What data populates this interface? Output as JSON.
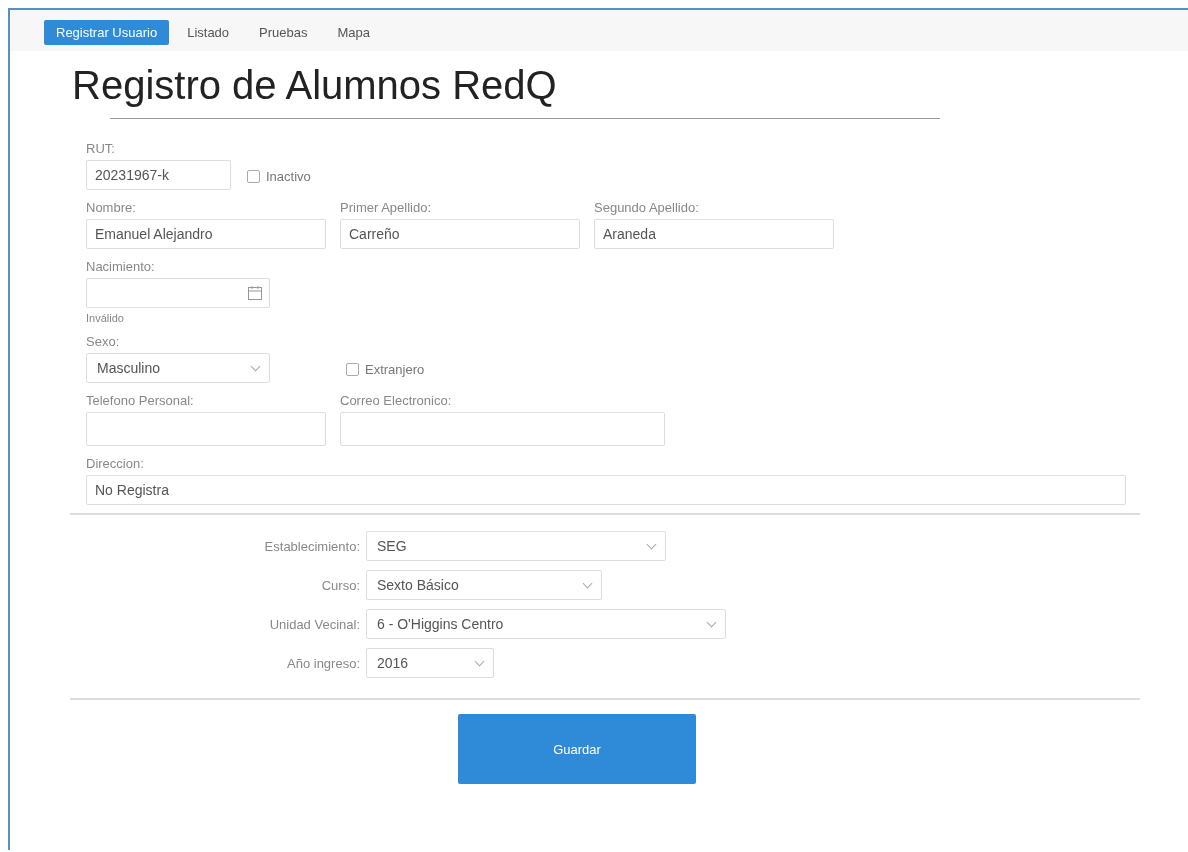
{
  "nav": [
    {
      "label": "Registrar Usuario",
      "selected": true
    },
    {
      "label": "Listado",
      "selected": false
    },
    {
      "label": "Pruebas",
      "selected": false
    },
    {
      "label": "Mapa",
      "selected": false
    }
  ],
  "title": "Registro de Alumnos RedQ",
  "rut": {
    "label": "RUT:",
    "value": "20231967-k"
  },
  "inactivo": {
    "label": "Inactivo",
    "checked": false
  },
  "names": [
    {
      "label": "Nombre:",
      "value": "Emanuel Alejandro"
    },
    {
      "label": "Primer Apellido:",
      "value": "Carreño"
    },
    {
      "label": "Segundo Apellido:",
      "value": "Araneda"
    }
  ],
  "nacimiento": {
    "label": "Nacimiento:",
    "note": "Inválido"
  },
  "sexo": {
    "label": "Sexo:",
    "value": "Masculino"
  },
  "extranjero": {
    "label": "Extranjero",
    "checked": false
  },
  "contact": [
    {
      "label": "Telefono Personal:"
    },
    {
      "label": "Correo Electronico:"
    }
  ],
  "direccion": {
    "label": "Direccion:",
    "value": "No Registra"
  },
  "selects": [
    {
      "label": "Establecimiento:",
      "value": "SEG"
    },
    {
      "label": "Curso:",
      "value": "Sexto Básico"
    },
    {
      "label": "Unidad Vecinal:",
      "value": "6 - O'Higgins Centro"
    },
    {
      "label": "Año ingreso:",
      "value": "2016"
    }
  ],
  "save": "Guardar"
}
